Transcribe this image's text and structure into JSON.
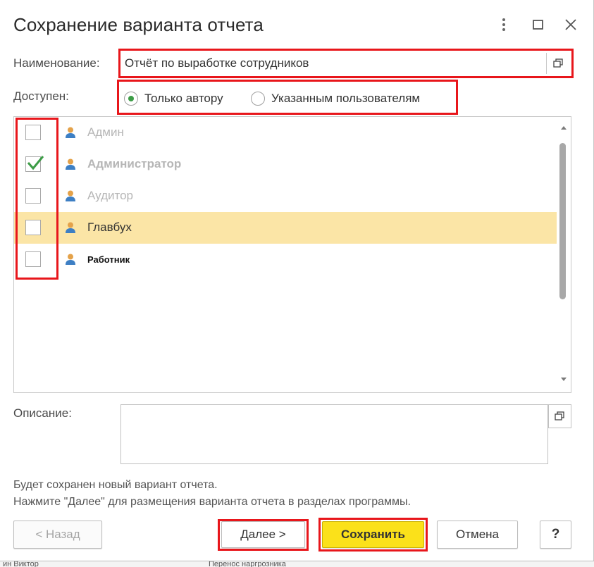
{
  "dialog": {
    "title": "Сохранение варианта отчета",
    "window_controls": [
      "more-icon",
      "maximize-icon",
      "close-icon"
    ]
  },
  "name_field": {
    "label": "Наименование:",
    "value": "Отчёт по выработке сотрудников"
  },
  "access": {
    "label": "Доступен:",
    "options": [
      {
        "label": "Только автору",
        "selected": true
      },
      {
        "label": "Указанным пользователям",
        "selected": false
      }
    ]
  },
  "users": [
    {
      "name": "Админ",
      "checked": false
    },
    {
      "name": "Администратор",
      "checked": true
    },
    {
      "name": "Аудитор",
      "checked": false
    },
    {
      "name": "Главбух",
      "checked": false,
      "selected": true
    },
    {
      "name": "Работник",
      "checked": false
    }
  ],
  "description": {
    "label": "Описание:",
    "value": ""
  },
  "info": {
    "line1": "Будет сохранен новый вариант отчета.",
    "line2": "Нажмите \"Далее\" для размещения варианта отчета в разделах программы."
  },
  "buttons": {
    "back": "<  Назад",
    "next": "Далее  >",
    "save": "Сохранить",
    "cancel": "Отмена",
    "help": "?"
  },
  "colors": {
    "highlight_frame": "#e8161b",
    "selected_row": "#fbe5a6",
    "primary_button": "#fbe11a",
    "check": "#3c9c46"
  },
  "background_strip": {
    "left_text": "ин Виктор",
    "right_text": "Перенос наргрозника"
  }
}
